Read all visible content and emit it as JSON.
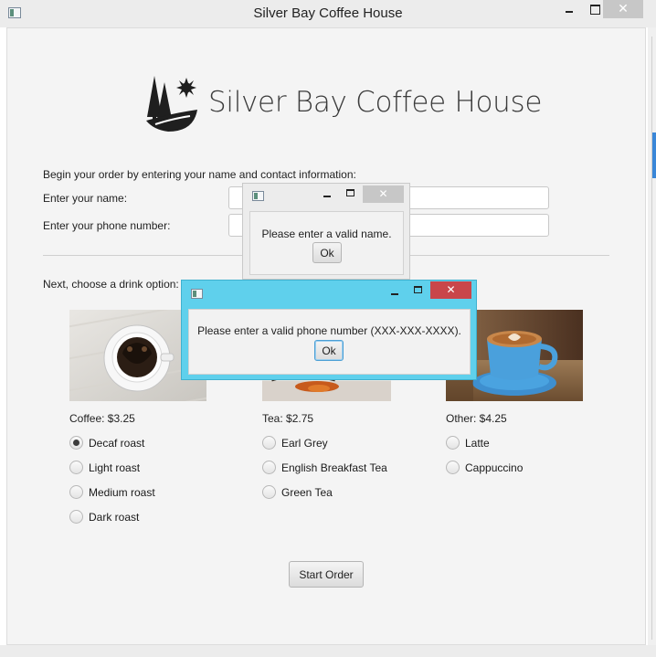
{
  "window": {
    "title": "Silver Bay Coffee House",
    "close_symbol": "✕"
  },
  "logo": {
    "text": "Silver Bay Coffee House",
    "icon": "pine-trees-sun-logo-icon"
  },
  "form": {
    "intro": "Begin your order by entering your name and contact information:",
    "name_label": "Enter your name:",
    "name_value": "",
    "phone_label": "Enter your phone number:",
    "phone_value": "",
    "drink_prompt": "Next, choose a drink option:"
  },
  "menu": {
    "coffee": {
      "label": "Coffee: $3.25",
      "options": [
        "Decaf roast",
        "Light roast",
        "Medium roast",
        "Dark roast"
      ],
      "selected": "Decaf roast"
    },
    "tea": {
      "label": "Tea: $2.75",
      "options": [
        "Earl Grey",
        "English Breakfast Tea",
        "Green Tea"
      ]
    },
    "other": {
      "label": "Other: $4.25",
      "options": [
        "Latte",
        "Cappuccino"
      ]
    }
  },
  "start_button": "Start Order",
  "dialogs": {
    "name_error": {
      "message": "Please enter a valid name.",
      "ok_label": "Ok",
      "close_symbol": "✕"
    },
    "phone_error": {
      "message": "Please enter a valid phone number (XXX-XXX-XXXX).",
      "ok_label": "Ok",
      "close_symbol": "✕",
      "active": true
    }
  },
  "colors": {
    "active_dialog_titlebar": "#5fd0ec",
    "active_close_button": "#c9464a",
    "inactive_titlebar": "#ececec",
    "inactive_close_button": "#c7c7c7"
  }
}
